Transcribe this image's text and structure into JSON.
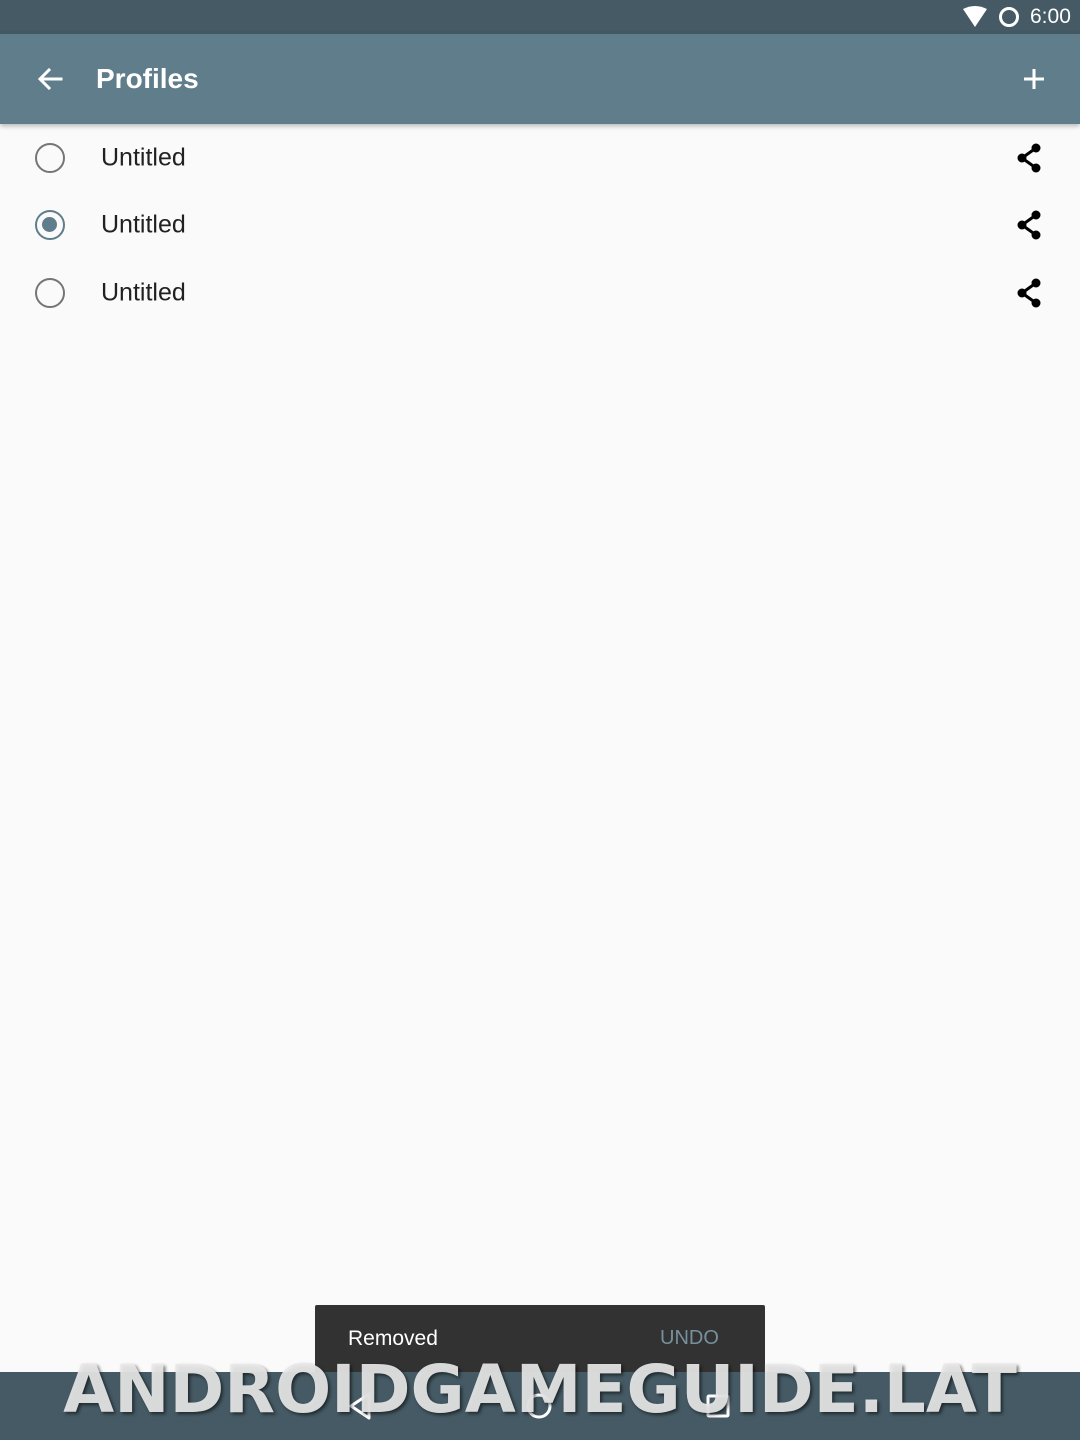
{
  "status_bar": {
    "time": "6:00",
    "icons": [
      "wifi-icon",
      "battery-icon"
    ]
  },
  "app_bar": {
    "title": "Profiles",
    "back_icon": "arrow-back-icon",
    "add_icon": "plus-icon"
  },
  "profiles": [
    {
      "name": "Untitled",
      "selected": false,
      "share_icon": "share-icon"
    },
    {
      "name": "Untitled",
      "selected": true,
      "share_icon": "share-icon"
    },
    {
      "name": "Untitled",
      "selected": false,
      "share_icon": "share-icon"
    }
  ],
  "snackbar": {
    "message": "Removed",
    "action": "UNDO"
  },
  "nav_bar": {
    "icons": [
      "back-triangle-icon",
      "home-circle-icon",
      "recents-square-icon"
    ]
  },
  "watermark": "ANDROIDGAMEGUIDE.LAT",
  "colors": {
    "status_bar": "#455a64",
    "app_bar": "#607d8b",
    "accent": "#607d8b",
    "background": "#fafafa",
    "snackbar": "#323232",
    "snackbar_action": "#78909c"
  }
}
